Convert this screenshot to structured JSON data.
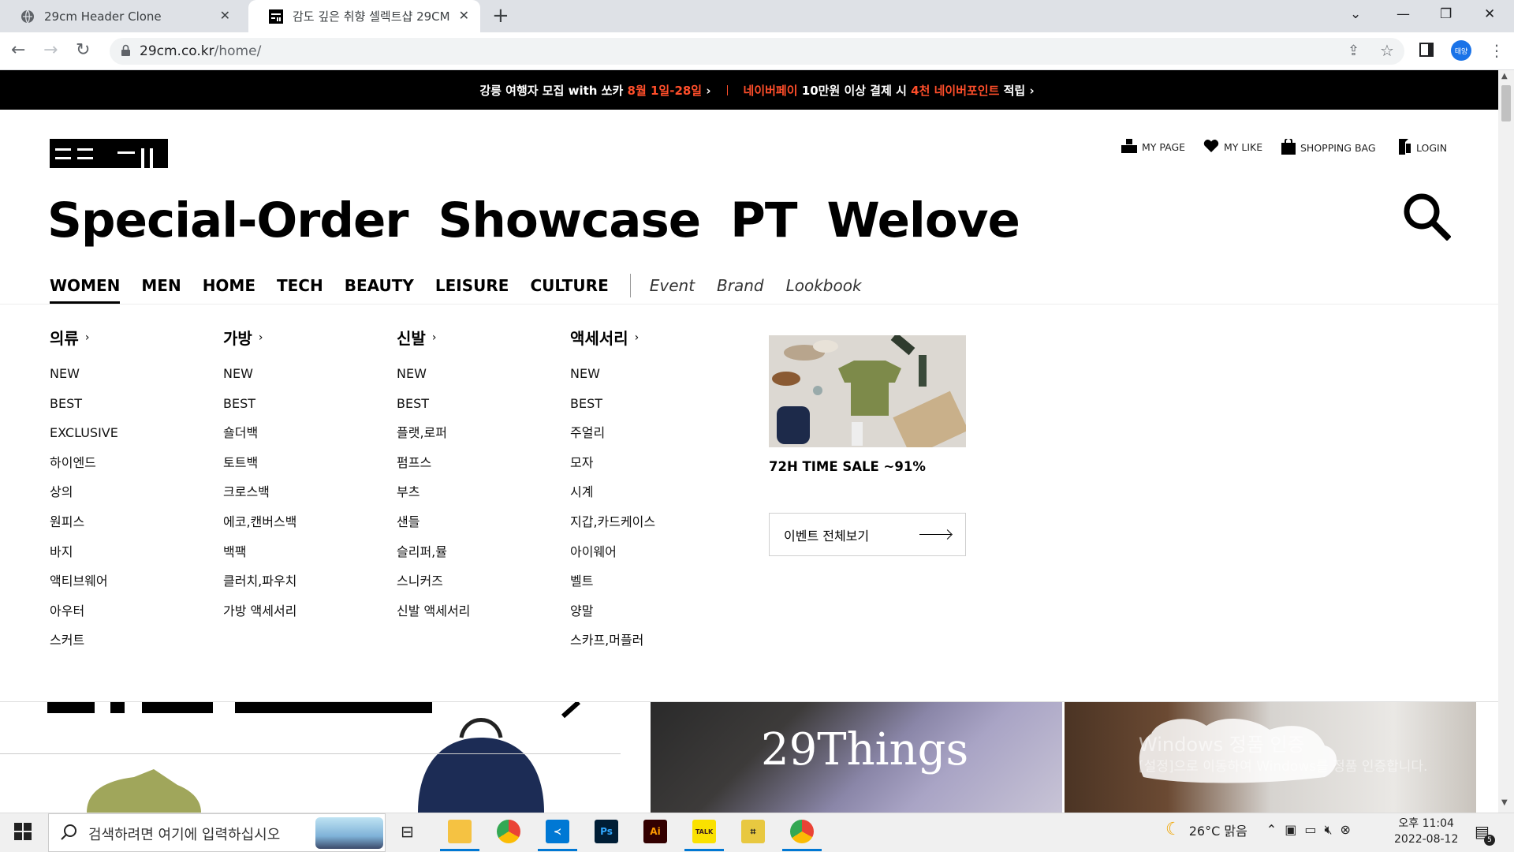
{
  "browser": {
    "tabs": [
      {
        "title": "29cm Header Clone",
        "active": false
      },
      {
        "title": "감도 깊은 취향 셀렉트샵 29CM",
        "active": true
      }
    ],
    "url_host": "29cm.co.kr",
    "url_path": "/home/",
    "profile_label": "태양"
  },
  "promo": {
    "left_prefix": "강릉 여행자 모집 with 쏘카 ",
    "left_highlight": "8월 1일-28일",
    "right_highlight1": "네이버페이",
    "right_mid1": " 10만원 이상 결제 시 ",
    "right_highlight2": "4천 네이버포인트",
    "right_suffix": " 적립"
  },
  "header": {
    "utility": [
      "MY PAGE",
      "MY LIKE",
      "SHOPPING BAG",
      "LOGIN"
    ],
    "main_menu": [
      "Special-Order",
      "Showcase",
      "PT",
      "Welove"
    ],
    "categories": [
      "WOMEN",
      "MEN",
      "HOME",
      "TECH",
      "BEAUTY",
      "LEISURE",
      "CULTURE"
    ],
    "secondary": [
      "Event",
      "Brand",
      "Lookbook"
    ],
    "active_category": "WOMEN"
  },
  "dropdown": {
    "columns": [
      {
        "title": "의류",
        "items": [
          "NEW",
          "BEST",
          "EXCLUSIVE",
          "하이엔드",
          "상의",
          "원피스",
          "바지",
          "액티브웨어",
          "아우터",
          "스커트"
        ]
      },
      {
        "title": "가방",
        "items": [
          "NEW",
          "BEST",
          "숄더백",
          "토트백",
          "크로스백",
          "에코,캔버스백",
          "백팩",
          "클러치,파우치",
          "가방 액세서리"
        ]
      },
      {
        "title": "신발",
        "items": [
          "NEW",
          "BEST",
          "플랫,로퍼",
          "펌프스",
          "부츠",
          "샌들",
          "슬리퍼,뮬",
          "스니커즈",
          "신발 액세서리"
        ]
      },
      {
        "title": "액세서리",
        "items": [
          "NEW",
          "BEST",
          "주얼리",
          "모자",
          "시계",
          "지갑,카드케이스",
          "아이웨어",
          "벨트",
          "양말",
          "스카프,머플러"
        ]
      }
    ],
    "promo_caption": "72H TIME SALE ~91%",
    "event_button": "이벤트 전체보기"
  },
  "content": {
    "banner_title": "29Things",
    "watermark_title": "Windows 정품 인증",
    "watermark_sub": "[설정]으로 이동하여 Windows를 정품 인증합니다."
  },
  "taskbar": {
    "search_placeholder": "검색하려면 여기에 입력하십시오",
    "weather": "26°C 맑음",
    "time_period": "오후 11:04",
    "date": "2022-08-12",
    "notification_count": "5"
  }
}
